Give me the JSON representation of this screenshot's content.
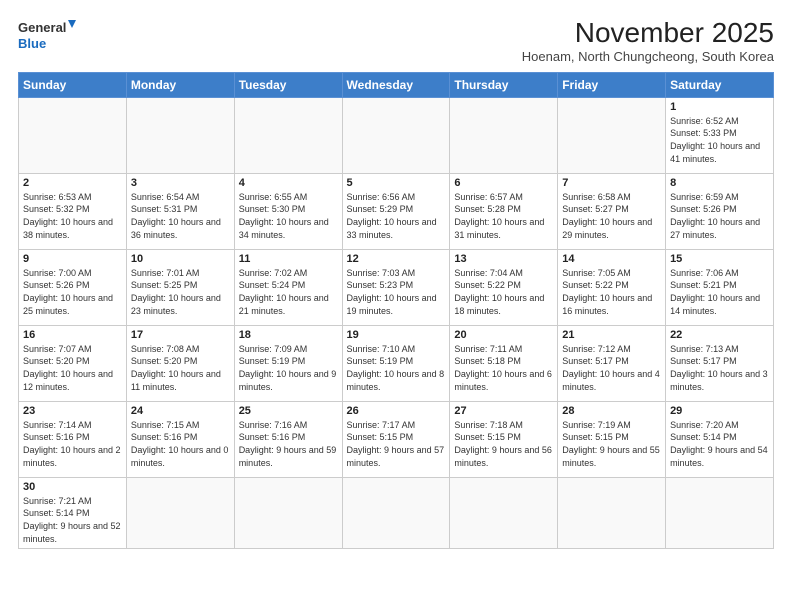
{
  "logo": {
    "line1": "General",
    "line2": "Blue"
  },
  "title": "November 2025",
  "subtitle": "Hoenam, North Chungcheong, South Korea",
  "days_header": [
    "Sunday",
    "Monday",
    "Tuesday",
    "Wednesday",
    "Thursday",
    "Friday",
    "Saturday"
  ],
  "weeks": [
    [
      {
        "day": "",
        "info": ""
      },
      {
        "day": "",
        "info": ""
      },
      {
        "day": "",
        "info": ""
      },
      {
        "day": "",
        "info": ""
      },
      {
        "day": "",
        "info": ""
      },
      {
        "day": "",
        "info": ""
      },
      {
        "day": "1",
        "info": "Sunrise: 6:52 AM\nSunset: 5:33 PM\nDaylight: 10 hours\nand 41 minutes."
      }
    ],
    [
      {
        "day": "2",
        "info": "Sunrise: 6:53 AM\nSunset: 5:32 PM\nDaylight: 10 hours\nand 38 minutes."
      },
      {
        "day": "3",
        "info": "Sunrise: 6:54 AM\nSunset: 5:31 PM\nDaylight: 10 hours\nand 36 minutes."
      },
      {
        "day": "4",
        "info": "Sunrise: 6:55 AM\nSunset: 5:30 PM\nDaylight: 10 hours\nand 34 minutes."
      },
      {
        "day": "5",
        "info": "Sunrise: 6:56 AM\nSunset: 5:29 PM\nDaylight: 10 hours\nand 33 minutes."
      },
      {
        "day": "6",
        "info": "Sunrise: 6:57 AM\nSunset: 5:28 PM\nDaylight: 10 hours\nand 31 minutes."
      },
      {
        "day": "7",
        "info": "Sunrise: 6:58 AM\nSunset: 5:27 PM\nDaylight: 10 hours\nand 29 minutes."
      },
      {
        "day": "8",
        "info": "Sunrise: 6:59 AM\nSunset: 5:26 PM\nDaylight: 10 hours\nand 27 minutes."
      }
    ],
    [
      {
        "day": "9",
        "info": "Sunrise: 7:00 AM\nSunset: 5:26 PM\nDaylight: 10 hours\nand 25 minutes."
      },
      {
        "day": "10",
        "info": "Sunrise: 7:01 AM\nSunset: 5:25 PM\nDaylight: 10 hours\nand 23 minutes."
      },
      {
        "day": "11",
        "info": "Sunrise: 7:02 AM\nSunset: 5:24 PM\nDaylight: 10 hours\nand 21 minutes."
      },
      {
        "day": "12",
        "info": "Sunrise: 7:03 AM\nSunset: 5:23 PM\nDaylight: 10 hours\nand 19 minutes."
      },
      {
        "day": "13",
        "info": "Sunrise: 7:04 AM\nSunset: 5:22 PM\nDaylight: 10 hours\nand 18 minutes."
      },
      {
        "day": "14",
        "info": "Sunrise: 7:05 AM\nSunset: 5:22 PM\nDaylight: 10 hours\nand 16 minutes."
      },
      {
        "day": "15",
        "info": "Sunrise: 7:06 AM\nSunset: 5:21 PM\nDaylight: 10 hours\nand 14 minutes."
      }
    ],
    [
      {
        "day": "16",
        "info": "Sunrise: 7:07 AM\nSunset: 5:20 PM\nDaylight: 10 hours\nand 12 minutes."
      },
      {
        "day": "17",
        "info": "Sunrise: 7:08 AM\nSunset: 5:20 PM\nDaylight: 10 hours\nand 11 minutes."
      },
      {
        "day": "18",
        "info": "Sunrise: 7:09 AM\nSunset: 5:19 PM\nDaylight: 10 hours\nand 9 minutes."
      },
      {
        "day": "19",
        "info": "Sunrise: 7:10 AM\nSunset: 5:19 PM\nDaylight: 10 hours\nand 8 minutes."
      },
      {
        "day": "20",
        "info": "Sunrise: 7:11 AM\nSunset: 5:18 PM\nDaylight: 10 hours\nand 6 minutes."
      },
      {
        "day": "21",
        "info": "Sunrise: 7:12 AM\nSunset: 5:17 PM\nDaylight: 10 hours\nand 4 minutes."
      },
      {
        "day": "22",
        "info": "Sunrise: 7:13 AM\nSunset: 5:17 PM\nDaylight: 10 hours\nand 3 minutes."
      }
    ],
    [
      {
        "day": "23",
        "info": "Sunrise: 7:14 AM\nSunset: 5:16 PM\nDaylight: 10 hours\nand 2 minutes."
      },
      {
        "day": "24",
        "info": "Sunrise: 7:15 AM\nSunset: 5:16 PM\nDaylight: 10 hours\nand 0 minutes."
      },
      {
        "day": "25",
        "info": "Sunrise: 7:16 AM\nSunset: 5:16 PM\nDaylight: 9 hours\nand 59 minutes."
      },
      {
        "day": "26",
        "info": "Sunrise: 7:17 AM\nSunset: 5:15 PM\nDaylight: 9 hours\nand 57 minutes."
      },
      {
        "day": "27",
        "info": "Sunrise: 7:18 AM\nSunset: 5:15 PM\nDaylight: 9 hours\nand 56 minutes."
      },
      {
        "day": "28",
        "info": "Sunrise: 7:19 AM\nSunset: 5:15 PM\nDaylight: 9 hours\nand 55 minutes."
      },
      {
        "day": "29",
        "info": "Sunrise: 7:20 AM\nSunset: 5:14 PM\nDaylight: 9 hours\nand 54 minutes."
      }
    ],
    [
      {
        "day": "30",
        "info": "Sunrise: 7:21 AM\nSunset: 5:14 PM\nDaylight: 9 hours\nand 52 minutes."
      },
      {
        "day": "",
        "info": ""
      },
      {
        "day": "",
        "info": ""
      },
      {
        "day": "",
        "info": ""
      },
      {
        "day": "",
        "info": ""
      },
      {
        "day": "",
        "info": ""
      },
      {
        "day": "",
        "info": ""
      }
    ]
  ]
}
